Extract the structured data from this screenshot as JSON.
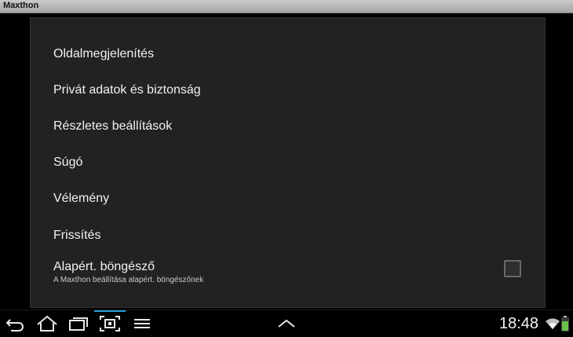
{
  "window": {
    "title": "Maxthon"
  },
  "settings": {
    "items": [
      {
        "label": "Oldalmegjelenítés"
      },
      {
        "label": "Privát adatok és biztonság"
      },
      {
        "label": "Részletes beállítások"
      },
      {
        "label": "Súgó"
      },
      {
        "label": "Vélemény"
      },
      {
        "label": "Frissítés"
      }
    ],
    "default_browser": {
      "label": "Alapért. böngésző",
      "description": "A Maxthon beállítása alapért. böngészőnek",
      "checked": false
    }
  },
  "navbar": {
    "buttons": [
      "back-icon",
      "home-icon",
      "recent-apps-icon",
      "screenshot-icon",
      "menu-icon",
      "up-chevron-icon"
    ],
    "accent_color": "#2a9dd6"
  },
  "status": {
    "time": "18:48",
    "icons": [
      "wifi-icon",
      "battery-icon"
    ],
    "battery_color": "#6cc04a"
  }
}
